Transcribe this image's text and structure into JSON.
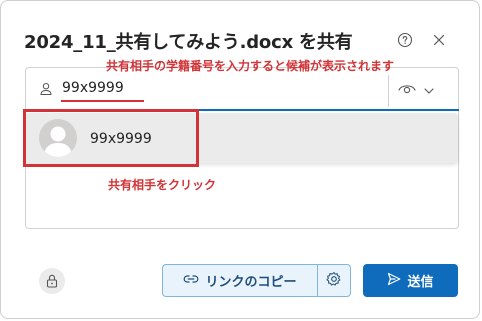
{
  "dialog": {
    "title": "2024_11_共有してみよう.docx を共有",
    "help_icon": "question-circle-icon",
    "close_icon": "close-icon"
  },
  "annotations": {
    "top": "共有相手の学籍番号を入力すると候補が表示されます",
    "bottom": "共有相手をクリック"
  },
  "people_picker": {
    "value": "99x9999",
    "person_icon": "person-icon",
    "permission_icon": "eye-icon",
    "chevron_icon": "chevron-down-icon"
  },
  "suggestions": [
    {
      "name": "99x9999",
      "avatar": "default-avatar"
    }
  ],
  "footer": {
    "lock_icon": "lock-icon",
    "copy_link_label": "リンクのコピー",
    "link_icon": "link-icon",
    "settings_icon": "gear-icon",
    "send_label": "送信",
    "send_icon": "send-icon"
  },
  "colors": {
    "accent": "#0f6cbd",
    "annotation": "#d13438",
    "copy_button_bg": "#e9f3fb",
    "suggestion_bg": "#ecebeb"
  }
}
